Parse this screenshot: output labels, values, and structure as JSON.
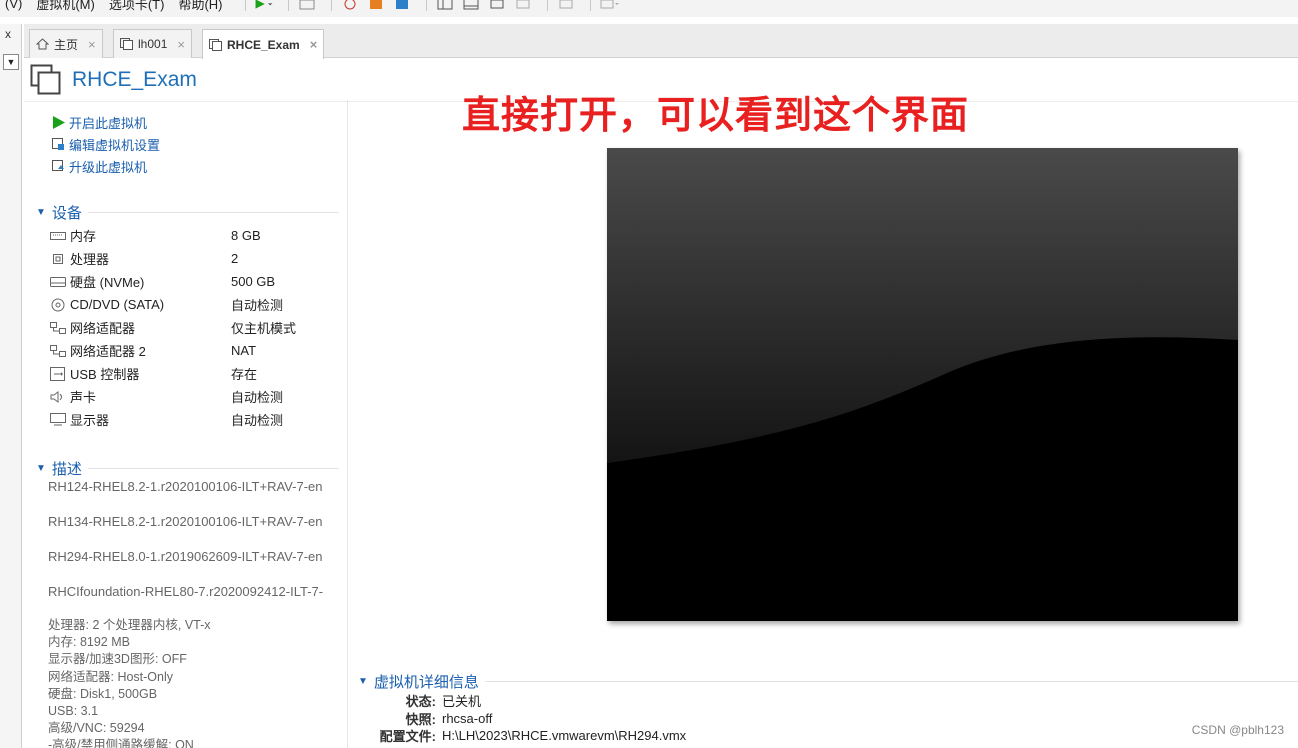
{
  "menu": {
    "items": [
      "(V)",
      "虚拟机(M)",
      "选项卡(T)",
      "帮助(H)"
    ]
  },
  "gutter": {
    "close_glyph": "x",
    "dropdown_glyph": "▼"
  },
  "tabs": [
    {
      "label": "主页",
      "icon": "home-icon",
      "close": "×",
      "active": false
    },
    {
      "label": "lh001",
      "icon": "vm-icon",
      "close": "×",
      "active": false
    },
    {
      "label": "RHCE_Exam",
      "icon": "vm-icon",
      "close": "×",
      "active": true
    }
  ],
  "vm": {
    "title": "RHCE_Exam"
  },
  "actions": [
    {
      "label": "开启此虚拟机",
      "icon": "play-icon"
    },
    {
      "label": "编辑虚拟机设置",
      "icon": "edit-settings-icon"
    },
    {
      "label": "升级此虚拟机",
      "icon": "upgrade-icon"
    }
  ],
  "devices_section": {
    "title": "设备",
    "toggle": "▼",
    "items": [
      {
        "name": "内存",
        "value": "8 GB",
        "icon": "memory-icon"
      },
      {
        "name": "处理器",
        "value": "2",
        "icon": "cpu-icon"
      },
      {
        "name": "硬盘 (NVMe)",
        "value": "500 GB",
        "icon": "disk-icon"
      },
      {
        "name": "CD/DVD (SATA)",
        "value": "自动检测",
        "icon": "cd-icon"
      },
      {
        "name": "网络适配器",
        "value": "仅主机模式",
        "icon": "network-icon"
      },
      {
        "name": "网络适配器 2",
        "value": "NAT",
        "icon": "network-icon"
      },
      {
        "name": "USB 控制器",
        "value": "存在",
        "icon": "usb-icon"
      },
      {
        "name": "声卡",
        "value": "自动检测",
        "icon": "sound-icon"
      },
      {
        "name": "显示器",
        "value": "自动检测",
        "icon": "display-icon"
      }
    ]
  },
  "description_section": {
    "title": "描述",
    "toggle": "▼",
    "lines": [
      "RH124-RHEL8.2-1.r2020100106-ILT+RAV-7-en",
      "RH134-RHEL8.2-1.r2020100106-ILT+RAV-7-en",
      "RH294-RHEL8.0-1.r2019062609-ILT+RAV-7-en",
      "RHCIfoundation-RHEL80-7.r2020092412-ILT-7-"
    ],
    "details": [
      "处理器: 2 个处理器内核, VT-x",
      "内存: 8192 MB",
      "显示器/加速3D图形: OFF",
      "网络适配器: Host-Only",
      "硬盘: Disk1, 500GB",
      "USB: 3.1",
      "高级/VNC: 59294",
      "-高级/禁用侧通路缓解: ON"
    ]
  },
  "annotation": "直接打开，可以看到这个界面",
  "vm_details_section": {
    "title": "虚拟机详细信息",
    "toggle": "▼",
    "rows": [
      {
        "label": "状态:",
        "value": "已关机"
      },
      {
        "label": "快照:",
        "value": "rhcsa-off"
      },
      {
        "label": "配置文件:",
        "value": "H:\\LH\\2023\\RHCE.vmwarevm\\RH294.vmx"
      }
    ]
  },
  "watermark": "CSDN @pblh123",
  "colors": {
    "link_blue": "#1a5fae",
    "title_blue": "#1f6fb8",
    "annotation_red": "#e8201f",
    "play_green": "#1aa11a"
  }
}
